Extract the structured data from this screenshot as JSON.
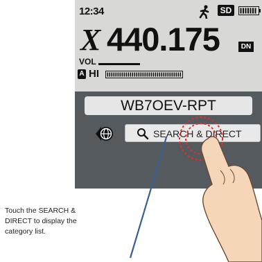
{
  "status_bar": {
    "clock": "12:34",
    "sd_badge": "SD",
    "icons": [
      "walking-person-icon",
      "battery-icon"
    ]
  },
  "frequency_display": {
    "mode_letter": "X",
    "frequency": "440.175",
    "mode_badge": "DN"
  },
  "audio": {
    "vol_label": "VOL",
    "band_badge": "A",
    "power_label": "HI"
  },
  "callsign_field": {
    "value": "WB7OEV-RPT"
  },
  "search_direct": {
    "label": "SEARCH & DIRECT",
    "icons": [
      "globe-icon",
      "magnifier-icon"
    ]
  },
  "caption": {
    "line1": "Touch the SEARCH  &",
    "line2": "DIRECT to display the",
    "line3": "category list."
  },
  "colors": {
    "screen_bg": "#d8d9d6",
    "panel_bg": "#545a5e",
    "touch_burst": "#e03030",
    "pointer_line": "#3b5f8f"
  }
}
